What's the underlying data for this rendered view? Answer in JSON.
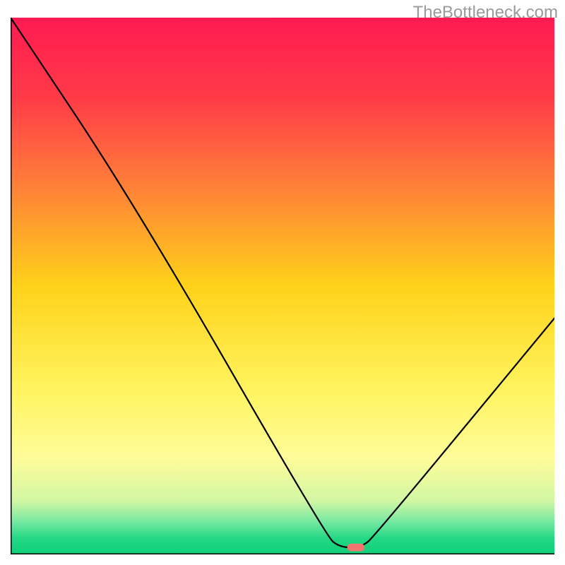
{
  "watermark": "TheBottleneck.com",
  "chart_data": {
    "type": "line",
    "title": "",
    "xlabel": "",
    "ylabel": "",
    "xlim": [
      0,
      100
    ],
    "ylim": [
      0,
      100
    ],
    "grid": false,
    "legend": false,
    "gradient_stops": [
      {
        "pos": 0.0,
        "color": "#ff1a51"
      },
      {
        "pos": 0.15,
        "color": "#ff3b48"
      },
      {
        "pos": 0.3,
        "color": "#ff7a3a"
      },
      {
        "pos": 0.5,
        "color": "#ffd21a"
      },
      {
        "pos": 0.7,
        "color": "#fff562"
      },
      {
        "pos": 0.82,
        "color": "#fffc9a"
      },
      {
        "pos": 0.9,
        "color": "#d2f7a4"
      },
      {
        "pos": 0.94,
        "color": "#74e8a1"
      },
      {
        "pos": 0.97,
        "color": "#23d885"
      },
      {
        "pos": 1.0,
        "color": "#0ecf77"
      }
    ],
    "series": [
      {
        "name": "bottleneck-curve",
        "color": "#000000",
        "points": [
          {
            "x": 0.0,
            "y": 100.0
          },
          {
            "x": 23.0,
            "y": 65.0
          },
          {
            "x": 58.0,
            "y": 3.5
          },
          {
            "x": 60.5,
            "y": 1.3
          },
          {
            "x": 64.5,
            "y": 1.3
          },
          {
            "x": 67.0,
            "y": 3.5
          },
          {
            "x": 100.0,
            "y": 44.0
          }
        ]
      }
    ],
    "marker": {
      "name": "optimal-point",
      "x": 63.5,
      "y": 1.3,
      "color": "#f3766e",
      "width": 3.2,
      "height": 1.4
    },
    "axes": {
      "left": {
        "from": [
          0,
          0
        ],
        "to": [
          0,
          100
        ]
      },
      "bottom": {
        "from": [
          0,
          0
        ],
        "to": [
          100,
          0
        ]
      }
    }
  }
}
